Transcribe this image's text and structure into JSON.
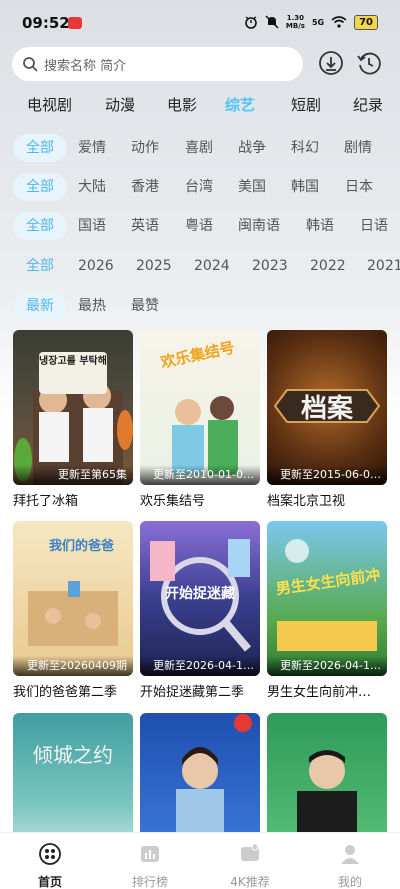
{
  "status": {
    "time": "09:52",
    "speed_top": "1.30",
    "speed_unit": "MB/s",
    "network": "5G",
    "battery": "70"
  },
  "search": {
    "placeholder": "搜索名称 简介"
  },
  "categories": [
    "电视剧",
    "动漫",
    "电影",
    "综艺",
    "短剧",
    "纪录"
  ],
  "active_category": "综艺",
  "filters": {
    "genre": [
      "全部",
      "爱情",
      "动作",
      "喜剧",
      "战争",
      "科幻",
      "剧情"
    ],
    "region": [
      "全部",
      "大陆",
      "香港",
      "台湾",
      "美国",
      "韩国",
      "日本"
    ],
    "language": [
      "全部",
      "国语",
      "英语",
      "粤语",
      "闽南语",
      "韩语",
      "日语"
    ],
    "year": [
      "全部",
      "2026",
      "2025",
      "2024",
      "2023",
      "2022",
      "2021"
    ],
    "sort": [
      "最新",
      "最热",
      "最赞"
    ]
  },
  "cards": [
    {
      "title": "拜托了冰箱",
      "update": "更新至第65集",
      "poster_text": "냉장고를 부탁해"
    },
    {
      "title": "欢乐集结号",
      "update": "更新至2010-01-0…",
      "poster_text": "欢乐集结号"
    },
    {
      "title": "档案北京卫视",
      "update": "更新至2015-06-0…",
      "poster_text": "档案"
    },
    {
      "title": "我们的爸爸第二季",
      "update": "更新至20260409期",
      "poster_text": "我们的爸爸"
    },
    {
      "title": "开始捉迷藏第二季",
      "update": "更新至2026-04-1…",
      "poster_text": "开始捉迷藏"
    },
    {
      "title": "男生女生向前冲…",
      "update": "更新至2026-04-1…",
      "poster_text": "男生女生向前冲"
    },
    {
      "title": "",
      "update": "",
      "poster_text": "倾城之约"
    },
    {
      "title": "",
      "update": "",
      "poster_text": ""
    },
    {
      "title": "",
      "update": "",
      "poster_text": ""
    }
  ],
  "bottom_nav": [
    {
      "label": "首页",
      "icon": "home-icon"
    },
    {
      "label": "排行榜",
      "icon": "ranking-icon"
    },
    {
      "label": "4K推荐",
      "icon": "4k-icon"
    },
    {
      "label": "我的",
      "icon": "profile-icon"
    }
  ],
  "colors": {
    "accent": "#4fc3f7",
    "chip_bg": "#e8f4fb"
  }
}
